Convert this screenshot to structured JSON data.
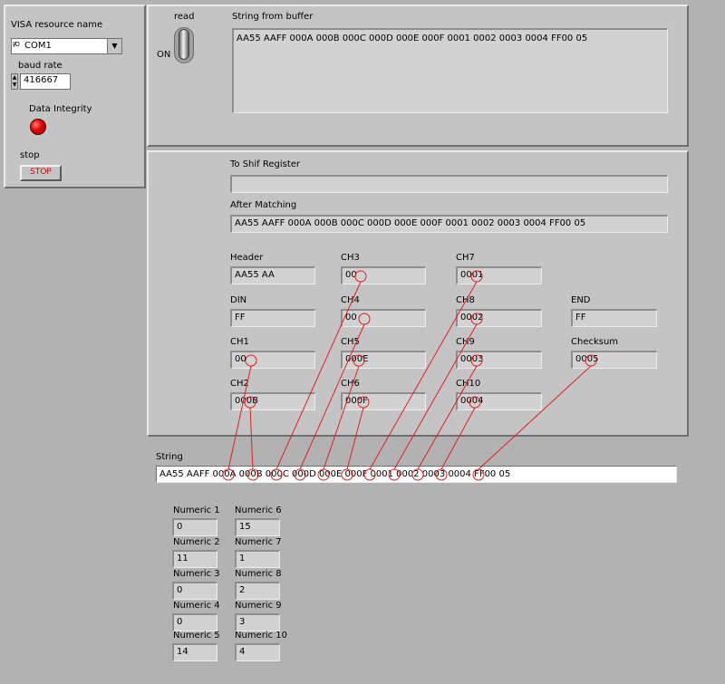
{
  "visa": {
    "label": "VISA resource name",
    "io_glyph": "I/O",
    "value": "COM1"
  },
  "baud": {
    "label": "baud rate",
    "value": "416667"
  },
  "integrity": {
    "label": "Data Integrity",
    "led_color": "#e00000"
  },
  "stop": {
    "label": "stop",
    "button": "STOP"
  },
  "read": {
    "label": "read",
    "state": "ON"
  },
  "buffer": {
    "label": "String from buffer",
    "value": "AA55 AAFF 000A 000B 000C 000D 000E 000F 0001 0002 0003 0004 FF00 05"
  },
  "shift": {
    "label": "To Shif Register",
    "value": ""
  },
  "matching": {
    "label": "After Matching",
    "value": "AA55 AAFF 000A 000B 000C 000D 000E 000F 0001 0002 0003 0004 FF00 05"
  },
  "fields": {
    "header": {
      "label": "Header",
      "value": "AA55 AA"
    },
    "din": {
      "label": "DIN",
      "value": "FF"
    },
    "ch1": {
      "label": "CH1",
      "value": "00"
    },
    "ch2": {
      "label": "CH2",
      "value": "000B"
    },
    "ch3": {
      "label": "CH3",
      "value": "00"
    },
    "ch4": {
      "label": "CH4",
      "value": "00"
    },
    "ch5": {
      "label": "CH5",
      "value": "000E"
    },
    "ch6": {
      "label": "CH6",
      "value": "000F"
    },
    "ch7": {
      "label": "CH7",
      "value": "0001"
    },
    "ch8": {
      "label": "CH8",
      "value": "0002"
    },
    "ch9": {
      "label": "CH9",
      "value": "0003"
    },
    "ch10": {
      "label": "CH10",
      "value": "0004"
    },
    "end": {
      "label": "END",
      "value": "FF"
    },
    "checksum": {
      "label": "Checksum",
      "value": "0005"
    }
  },
  "string": {
    "label": "String",
    "value": "AA55 AAFF 000A 000B 000C 000D 000E 000F 0001 0002 0003 0004 FF00 05"
  },
  "numerics": [
    {
      "label": "Numeric 1",
      "value": "0"
    },
    {
      "label": "Numeric 2",
      "value": "11"
    },
    {
      "label": "Numeric 3",
      "value": "0"
    },
    {
      "label": "Numeric 4",
      "value": "0"
    },
    {
      "label": "Numeric 5",
      "value": "14"
    },
    {
      "label": "Numeric 6",
      "value": "15"
    },
    {
      "label": "Numeric 7",
      "value": "1"
    },
    {
      "label": "Numeric 8",
      "value": "2"
    },
    {
      "label": "Numeric 9",
      "value": "3"
    },
    {
      "label": "Numeric 10",
      "value": "4"
    }
  ],
  "colors": {
    "annotation": "#e02020",
    "led": "#e00000"
  }
}
